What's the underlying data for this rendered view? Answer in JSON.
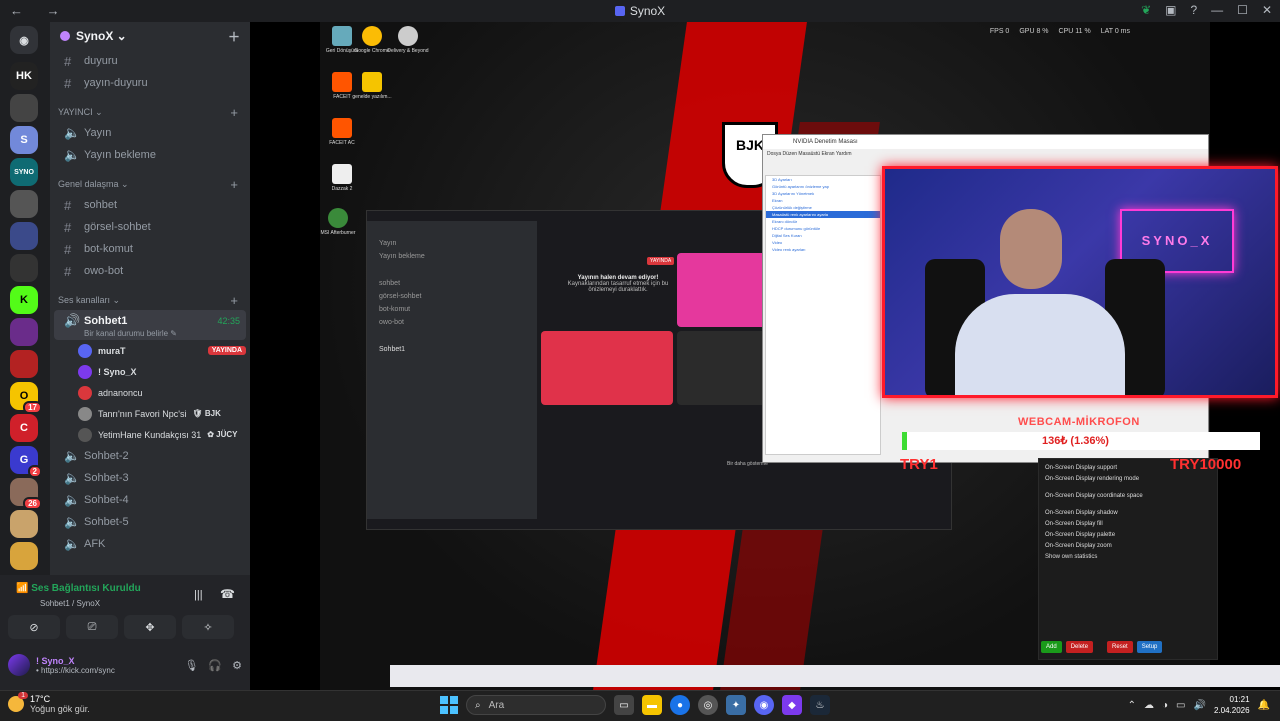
{
  "titlebar": {
    "title": "SynoX"
  },
  "server": {
    "name": "SynoX ⌄"
  },
  "channels_top": [
    "duyuru",
    "yayın-duyuru"
  ],
  "categories": [
    {
      "name": "YAYINCI ⌄",
      "channels": [
        "Yayın",
        "Yayın bekleme"
      ],
      "voice": true
    },
    {
      "name": "Genel dalaşma ⌄",
      "channels": [
        "sohbet",
        "görsel-sohbet",
        "bot-komut",
        "owo-bot"
      ],
      "voice": false
    }
  ],
  "voice_category": "Ses kanalları ⌄",
  "active_voice": {
    "name": "Sohbet1",
    "timer": "42:35",
    "status": "Bir kanal durumu belirle ✎"
  },
  "voice_users": [
    {
      "name": "muraT",
      "live": "YAYINDA",
      "color": "#5865f2"
    },
    {
      "name": "! Syno_X",
      "live": "",
      "color": "#7c3aed"
    },
    {
      "name": "adnanoncu",
      "live": "",
      "color": "#da373c"
    },
    {
      "name": "Tanrı'nın Favori Npc'si",
      "role": "🛡 BJK",
      "color": "#888"
    },
    {
      "name": "YetimHane Kundakçısı 31",
      "role": "✿ JÜCY",
      "color": "#555"
    }
  ],
  "voice_channels": [
    "Sohbet-2",
    "Sohbet-3",
    "Sohbet-4",
    "Sohbet-5",
    "AFK"
  ],
  "voice_panel": {
    "status": "Ses Bağlantısı Kuruldu",
    "sub": "Sohbet1 / SynoX",
    "user": "! Syno_X",
    "user_sub": "• https://kick.com/sync"
  },
  "overlay": {
    "fps": "FPS 0",
    "gpu": "GPU 8 %",
    "cpu": "CPU 11 %",
    "lat": "LAT 0 ms"
  },
  "stream": {
    "webcam_label": "WEBCAM-MİKROFON",
    "goal": "136₺ (1.36%)",
    "goal_progress": 0.0136,
    "try_left": "TRY1",
    "try_right": "TRY10000",
    "neon_sign": "SYNO_X",
    "crest": "BJK",
    "nvidia_title": "NVIDIA Denetim Masası",
    "nvidia_menu": "Dosya   Düzen   Masaüstü   Ekran   Yardım",
    "nvidia_tree": [
      "3D Ayarları",
      "Görüntü ayarlarını önizleme yap",
      "3D Ayarlarını Yönetmek",
      "Ekran",
      "Çözünürlük değiştirme",
      "Masaüstü renk ayarlarını ayarla",
      "Ekranı döndür",
      "HDCP durumunu görüntüle",
      "Dijital Ses Kuran",
      "Video",
      "Video renk ayarları"
    ],
    "inner_discord": {
      "msg1": "Yayının halen devam ediyor!",
      "msg2": "Kaynaklarından tasarruf etmek için bu önizlemeyi duraklattık.",
      "live": "YAYINDA",
      "dont_show": "Bir daha gösterme"
    },
    "osd_rows": [
      "On-Screen Display support",
      "On-Screen Display rendering mode",
      "On-Screen Display coordinate space",
      "On-Screen Display shadow",
      "On-Screen Display fill",
      "On-Screen Display palette",
      "On-Screen Display zoom",
      "Show own statistics"
    ],
    "osd_buttons": [
      "Add",
      "Delete",
      "Reset",
      "Setup"
    ],
    "desktop_icons": [
      "Geri Dönüşüm",
      "Google Chrome",
      "Delivery & Beyond",
      "FACEIT",
      "genelde yazılım...",
      "FACEIT AC",
      "Dazzak 2",
      "MSI Afterburner"
    ]
  },
  "taskbar": {
    "temp": "17°C",
    "weather": "Yoğun gök gür.",
    "weather_badge": "1",
    "search": "Ara",
    "time": "01:21",
    "date": "2.04.2026"
  }
}
